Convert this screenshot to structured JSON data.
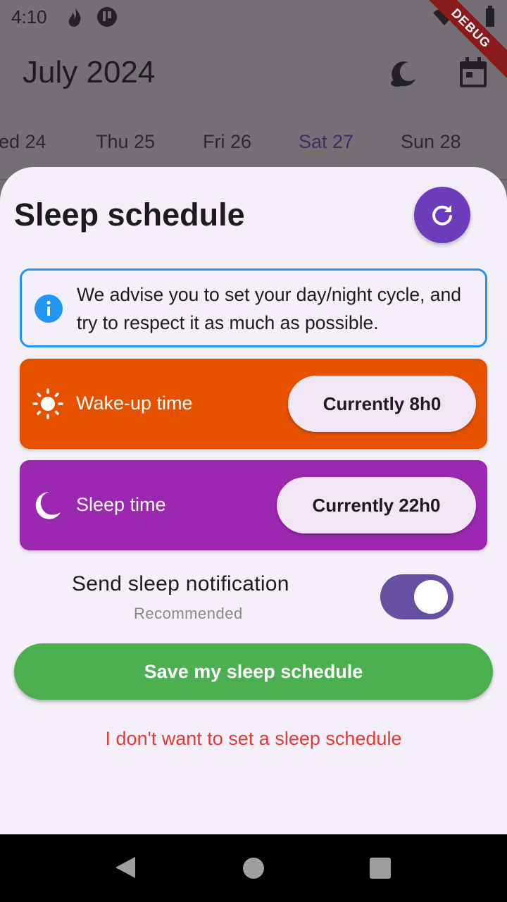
{
  "status_bar": {
    "time": "4:10",
    "debug_label": "DEBUG"
  },
  "header": {
    "month_title": "July 2024"
  },
  "days": [
    {
      "label": "ed 24",
      "selected": false
    },
    {
      "label": "Thu 25",
      "selected": false
    },
    {
      "label": "Fri 26",
      "selected": false
    },
    {
      "label": "Sat 27",
      "selected": true
    },
    {
      "label": "Sun 28",
      "selected": false
    }
  ],
  "sheet": {
    "title": "Sleep schedule",
    "info_text": "We advise you to set your day/night cycle, and try to respect it as much as possible.",
    "wake": {
      "label": "Wake-up time",
      "current": "Currently 8h0",
      "color": "#e65100"
    },
    "sleep": {
      "label": "Sleep time",
      "current": "Currently 22h0",
      "color": "#9c27b0"
    },
    "notification": {
      "label": "Send sleep notification",
      "sub": "Recommended",
      "enabled": true
    },
    "save_label": "Save my sleep schedule",
    "decline_label": "I don't want to set a sleep schedule"
  },
  "colors": {
    "accent": "#6c3cbc",
    "save": "#4caf50",
    "decline": "#e53935",
    "info": "#2196f3"
  },
  "icons": [
    "refresh-icon",
    "info-icon",
    "sun-icon",
    "moon-icon",
    "calendar-icon",
    "sleep-moon-icon"
  ]
}
